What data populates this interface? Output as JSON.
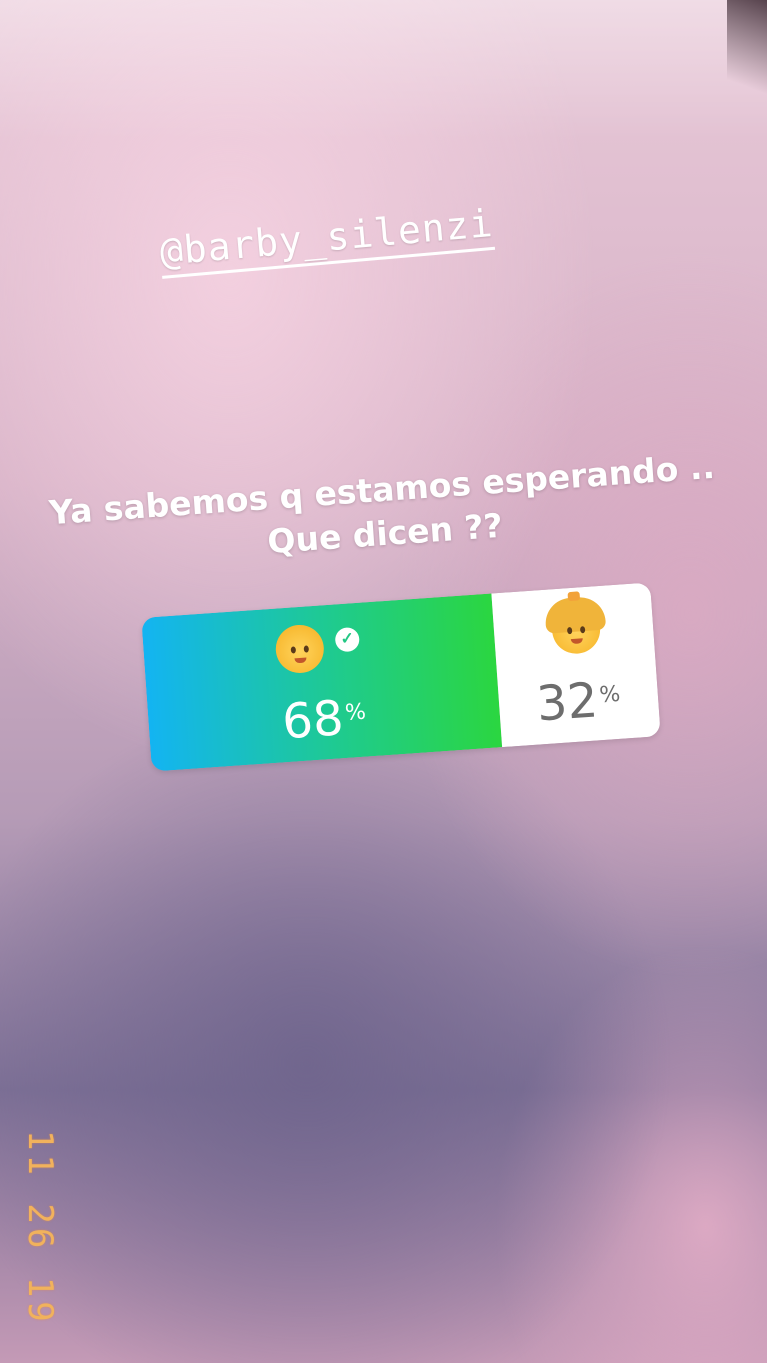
{
  "story": {
    "mention": "@barby_silenzi",
    "question": {
      "line1": "Ya sabemos q estamos esperando ..",
      "line2": "Que dicen ??"
    },
    "poll": {
      "options": [
        {
          "emoji": "baby",
          "percent": "68",
          "unit": "%",
          "selected": true,
          "share": 0.68
        },
        {
          "emoji": "girl",
          "percent": "32",
          "unit": "%",
          "selected": false,
          "share": 0.32
        }
      ],
      "colors": {
        "left_start": "#13b4f2",
        "left_end": "#2bd640",
        "right": "#ffffff"
      }
    },
    "datestamp": "11 26 19"
  }
}
